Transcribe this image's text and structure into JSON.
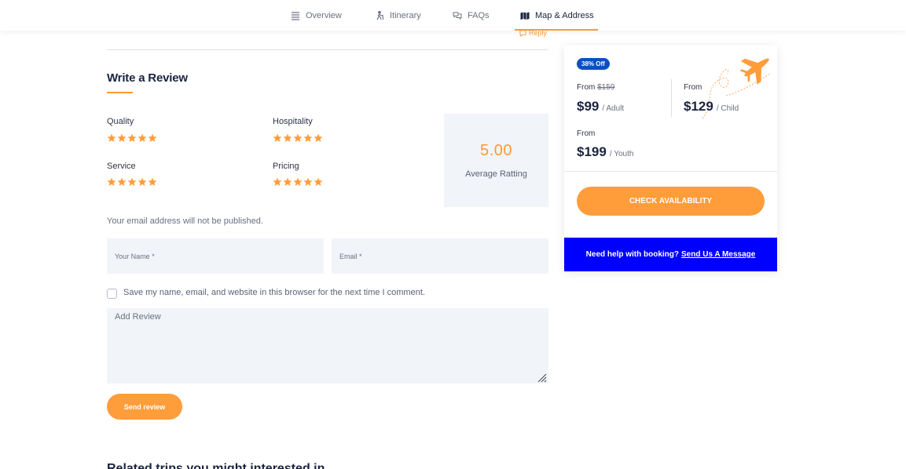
{
  "nav": {
    "items": [
      {
        "label": "Overview",
        "icon": "list-icon"
      },
      {
        "label": "Itinerary",
        "icon": "hiker-icon"
      },
      {
        "label": "FAQs",
        "icon": "chat-bubbles-icon"
      },
      {
        "label": "Map & Address",
        "icon": "map-icon"
      }
    ],
    "active": "Map & Address"
  },
  "reply_label": "Reply",
  "review": {
    "title": "Write a Review",
    "ratings": [
      {
        "label": "Quality",
        "stars": 5
      },
      {
        "label": "Hospitality",
        "stars": 5
      },
      {
        "label": "Service",
        "stars": 5
      },
      {
        "label": "Pricing",
        "stars": 5
      }
    ],
    "average_value": "5.00",
    "average_label": "Average Ratting",
    "note": "Your email address will not be published.",
    "name_placeholder": "Your Name *",
    "email_placeholder": "Email *",
    "save_label": "Save my name, email, and website in this browser for the next time I comment.",
    "review_placeholder": "Add Review",
    "send_label": "Send review"
  },
  "related_heading": "Related trips you might interested in",
  "booking": {
    "badge": "38% Off",
    "adult": {
      "from": "From",
      "old_price": "$159",
      "price": "$99",
      "unit": "/ Adult"
    },
    "child": {
      "from": "From",
      "price": "$129",
      "unit": "/ Child"
    },
    "youth": {
      "from": "From",
      "price": "$199",
      "unit": "/ Youth"
    },
    "check_label": "CHECK AVAILABILITY",
    "help_text": "Need help with booking?",
    "help_link": "Send Us A Message"
  },
  "colors": {
    "accent": "#ff9d3b",
    "navy": "#1a2340",
    "badge": "#0a4fc4",
    "help_bar": "#0000ff",
    "field_bg": "#f1f4f9"
  }
}
